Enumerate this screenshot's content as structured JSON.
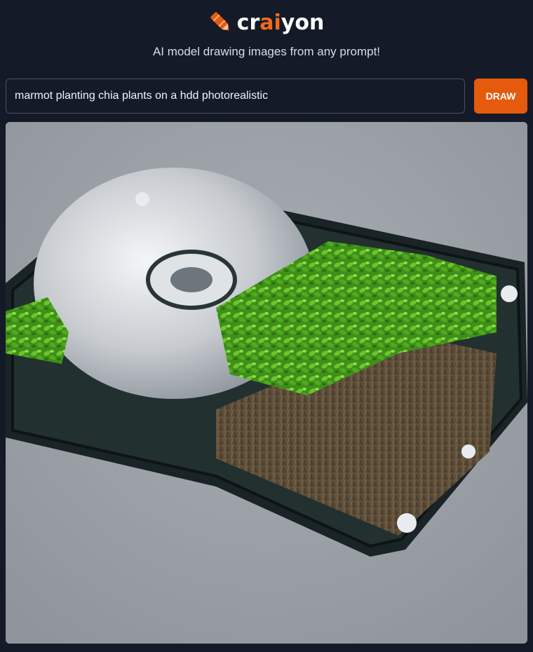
{
  "brand": {
    "name_parts": [
      "cr",
      "ai",
      "yon"
    ],
    "accent_color": "#f06a1d",
    "logo_icon": "crayon-icon"
  },
  "tagline": "AI model drawing images from any prompt!",
  "prompt": {
    "value": "marmot planting chia plants on a hdd photorealistic",
    "placeholder": ""
  },
  "draw_button": {
    "label": "DRAW",
    "color": "#e55a0d"
  },
  "result": {
    "image_name": "generated-image",
    "background_color": "#9aa0a6"
  },
  "colors": {
    "page_background": "#141a27",
    "input_border": "#4a5264"
  }
}
